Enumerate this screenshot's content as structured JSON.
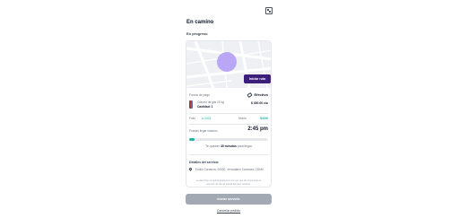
{
  "header": {
    "title": "En camino",
    "status": "En progreso",
    "qr_icon": "qr-code-icon"
  },
  "map": {
    "start_route_label": "Iniciar ruta"
  },
  "payment": {
    "label": "Forma de pago",
    "method": "Efectivo",
    "icon": "tag-icon"
  },
  "product": {
    "name": "Cilindro de gas 20 kg",
    "quantity": "Cantidad: 1",
    "price": "$ 300.00 c/u"
  },
  "order": {
    "folio_label": "Folio",
    "folio_value": "A-0001",
    "amount_label": "Monto",
    "amount_value": "$300"
  },
  "eta": {
    "label": "Puedes llegar máximo",
    "time": "2:45 pm",
    "progress": 0.07,
    "remaining_prefix": "Te quedan",
    "remaining_value": "40 minutos",
    "remaining_suffix": "para llegar"
  },
  "details": {
    "title": "Detalles del servicio",
    "address": "Emilio Carranza, 00000, Venustiano Carranza, CDMX",
    "note": "La dirección completa aparecerá una vez que las comiences el servicio. El cliente estará allí para recibirte.",
    "pin_icon": "location-pin-icon"
  },
  "actions": {
    "start_service_label": "Iniciar servicio",
    "cancel_label": "Cancelar pedido"
  },
  "colors": {
    "accent": "#1db5a8",
    "button_dark": "#3b1f7a",
    "map_pin": "#b9a7f5"
  }
}
